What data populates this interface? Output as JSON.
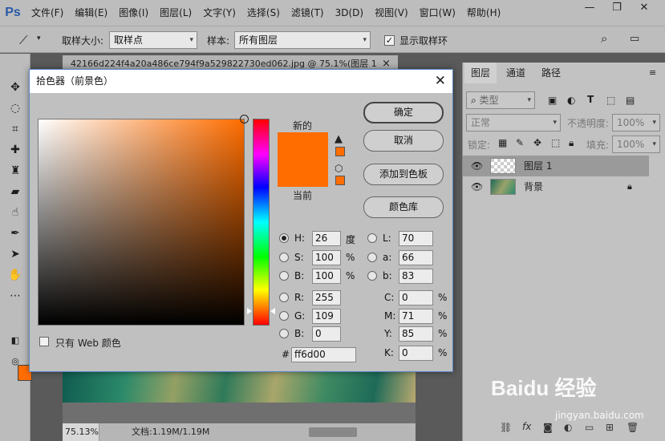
{
  "app": {
    "logo": "Ps"
  },
  "menu": [
    "文件(F)",
    "编辑(E)",
    "图像(I)",
    "图层(L)",
    "文字(Y)",
    "选择(S)",
    "滤镜(T)",
    "3D(D)",
    "视图(V)",
    "窗口(W)",
    "帮助(H)"
  ],
  "window_controls": {
    "minimize": "—",
    "restore": "❐",
    "close": "✕"
  },
  "options_bar": {
    "sample_size_label": "取样大小:",
    "sample_size_value": "取样点",
    "sample_label": "样本:",
    "sample_value": "所有图层",
    "show_ring_label": "显示取样环",
    "show_ring_checked": true
  },
  "document": {
    "tab_title": "42166d224f4a20a486ce794f9a529822730ed062.jpg @ 75.1%(图层 1",
    "tab_close": "×",
    "zoom": "75.13%",
    "doc_info": "文档:1.19M/1.19M"
  },
  "foreground_color": "#ff6d00",
  "color_picker": {
    "title": "拾色器（前景色）",
    "close": "✕",
    "label_new": "新的",
    "label_current": "当前",
    "web_only_label": "只有 Web 颜色",
    "web_only_checked": false,
    "buttons": {
      "ok": "确定",
      "cancel": "取消",
      "add_to_swatches": "添加到色板",
      "color_libraries": "颜色库"
    },
    "hsb": {
      "h": {
        "label": "H:",
        "value": "26",
        "unit": "度",
        "selected": true
      },
      "s": {
        "label": "S:",
        "value": "100",
        "unit": "%"
      },
      "b": {
        "label": "B:",
        "value": "100",
        "unit": "%"
      }
    },
    "rgb": {
      "r": {
        "label": "R:",
        "value": "255"
      },
      "g": {
        "label": "G:",
        "value": "109"
      },
      "b": {
        "label": "B:",
        "value": "0"
      }
    },
    "lab": {
      "l": {
        "label": "L:",
        "value": "70"
      },
      "a": {
        "label": "a:",
        "value": "66"
      },
      "b": {
        "label": "b:",
        "value": "83"
      }
    },
    "cmyk": {
      "c": {
        "label": "C:",
        "value": "0",
        "unit": "%"
      },
      "m": {
        "label": "M:",
        "value": "71",
        "unit": "%"
      },
      "y": {
        "label": "Y:",
        "value": "85",
        "unit": "%"
      },
      "k": {
        "label": "K:",
        "value": "0",
        "unit": "%"
      }
    },
    "hex_label": "#",
    "hex_value": "ff6d00",
    "hue_level": 0.07
  },
  "layers_panel": {
    "tabs": [
      "图层",
      "通道",
      "路径"
    ],
    "filter_label": "类型",
    "blend_mode": "正常",
    "opacity_label": "不透明度:",
    "opacity_value": "100%",
    "lock_label": "锁定:",
    "fill_label": "填充:",
    "fill_value": "100%",
    "layers": [
      {
        "name": "图层 1",
        "selected": true
      },
      {
        "name": "背景",
        "locked": true
      }
    ]
  },
  "watermark": {
    "brand": "Baidu 经验",
    "url": "jingyan.baidu.com"
  }
}
